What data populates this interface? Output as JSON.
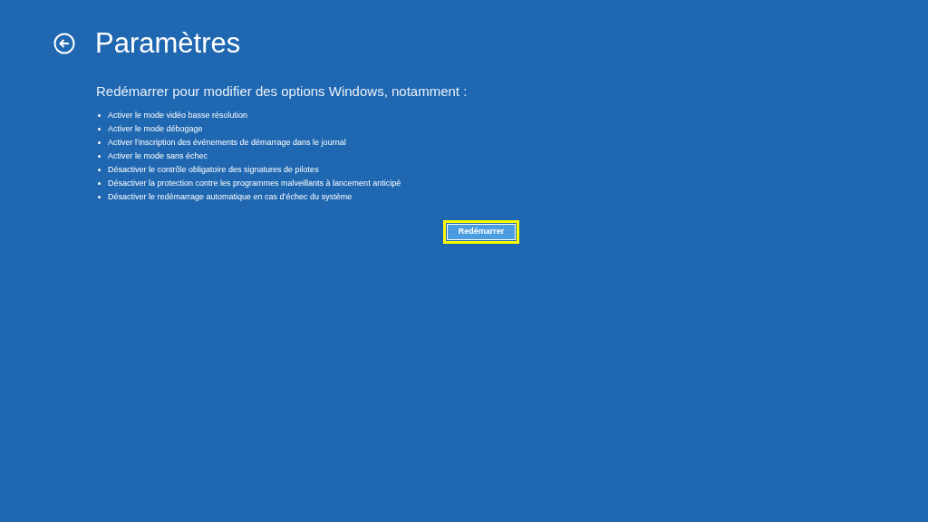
{
  "header": {
    "title": "Paramètres"
  },
  "intro": "Redémarrer pour modifier des options Windows, notamment :",
  "options": [
    "Activer le mode vidéo basse résolution",
    "Activer le mode débogage",
    "Activer l’inscription des événements de démarrage dans le journal",
    "Activer le mode sans échec",
    "Désactiver le contrôle obligatoire des signatures de pilotes",
    "Désactiver la protection contre les programmes malveillants à lancement anticipé",
    "Désactiver le redémarrage automatique en cas d’échec du système"
  ],
  "restart_button": {
    "label": "Redémarrer",
    "focused": true
  }
}
